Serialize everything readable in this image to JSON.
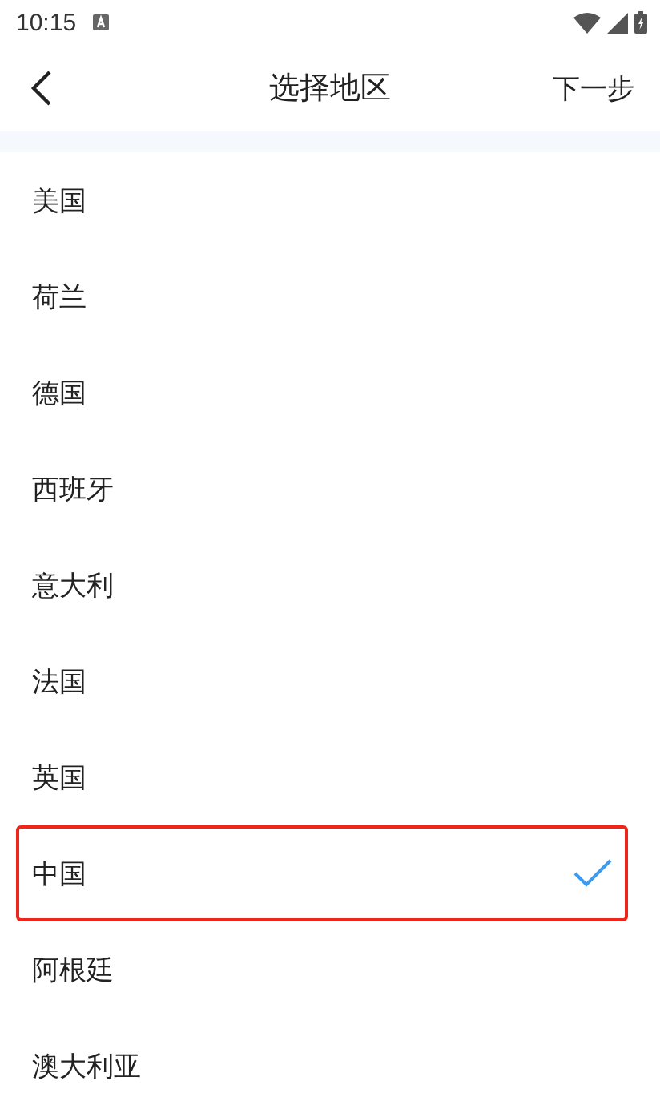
{
  "status_bar": {
    "time": "10:15"
  },
  "header": {
    "title": "选择地区",
    "next": "下一步"
  },
  "regions": [
    {
      "name": "美国",
      "selected": false,
      "highlighted": false
    },
    {
      "name": "荷兰",
      "selected": false,
      "highlighted": false
    },
    {
      "name": "德国",
      "selected": false,
      "highlighted": false
    },
    {
      "name": "西班牙",
      "selected": false,
      "highlighted": false
    },
    {
      "name": "意大利",
      "selected": false,
      "highlighted": false
    },
    {
      "name": "法国",
      "selected": false,
      "highlighted": false
    },
    {
      "name": "英国",
      "selected": false,
      "highlighted": false
    },
    {
      "name": "中国",
      "selected": true,
      "highlighted": true
    },
    {
      "name": "阿根廷",
      "selected": false,
      "highlighted": false
    },
    {
      "name": "澳大利亚",
      "selected": false,
      "highlighted": false
    }
  ]
}
